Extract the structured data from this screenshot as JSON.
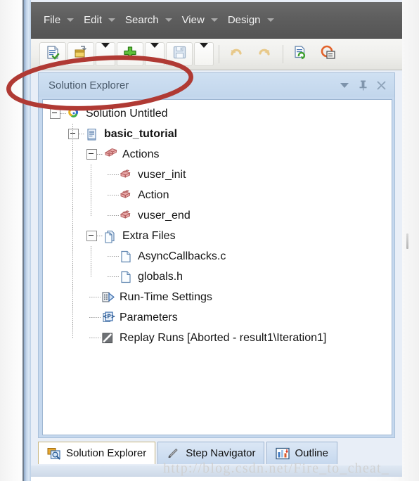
{
  "menubar": {
    "items": [
      {
        "label": "File",
        "accel": "F",
        "name": "menu-file"
      },
      {
        "label": "Edit",
        "accel": "E",
        "name": "menu-edit"
      },
      {
        "label": "Search",
        "accel": "S",
        "name": "menu-search"
      },
      {
        "label": "View",
        "accel": "V",
        "name": "menu-view"
      },
      {
        "label": "Design",
        "accel": "D",
        "name": "menu-design"
      }
    ]
  },
  "toolbar": {
    "buttons": [
      {
        "name": "new-script-button",
        "icon": "new-script-icon"
      },
      {
        "name": "open-solution-button",
        "icon": "open-folder-icon"
      },
      {
        "name": "open-dropdown-button",
        "icon": "chevron-down-icon"
      },
      {
        "name": "add-button",
        "icon": "green-plus-icon"
      },
      {
        "name": "add-dropdown-button",
        "icon": "chevron-down-icon"
      },
      {
        "name": "save-button",
        "icon": "floppy-save-icon"
      },
      {
        "name": "save-dropdown-button",
        "icon": "chevron-down-icon"
      },
      {
        "name": "undo-button",
        "icon": "undo-arrow-icon"
      },
      {
        "name": "redo-button",
        "icon": "redo-arrow-icon"
      },
      {
        "name": "refresh-script-button",
        "icon": "refresh-script-icon"
      },
      {
        "name": "record-button",
        "icon": "record-icon"
      }
    ]
  },
  "panel": {
    "title": "Solution Explorer",
    "header_buttons": [
      {
        "name": "panel-menu-button",
        "icon": "chevron-down-icon",
        "glyph": ""
      },
      {
        "name": "panel-pin-button",
        "icon": "pin-icon",
        "glyph": "⍑"
      },
      {
        "name": "panel-close-button",
        "icon": "close-icon",
        "glyph": "✕"
      }
    ]
  },
  "tree": {
    "nodes": [
      {
        "label": "Solution Untitled",
        "depth": 0,
        "icon": "solution-icon",
        "expander": "minus",
        "bold": false,
        "name": "tree-node-solution-untitled"
      },
      {
        "label": "basic_tutorial",
        "depth": 1,
        "icon": "script-icon",
        "expander": "minus",
        "bold": true,
        "name": "tree-node-basic-tutorial"
      },
      {
        "label": "Actions",
        "depth": 2,
        "icon": "actions-icon",
        "expander": "minus",
        "bold": false,
        "name": "tree-node-actions"
      },
      {
        "label": "vuser_init",
        "depth": 3,
        "icon": "action-block-icon",
        "expander": "none",
        "bold": false,
        "name": "tree-node-vuser-init"
      },
      {
        "label": "Action",
        "depth": 3,
        "icon": "action-block-icon",
        "expander": "none",
        "bold": false,
        "name": "tree-node-action"
      },
      {
        "label": "vuser_end",
        "depth": 3,
        "icon": "action-block-icon",
        "expander": "none",
        "bold": false,
        "name": "tree-node-vuser-end"
      },
      {
        "label": "Extra Files",
        "depth": 2,
        "icon": "extra-files-icon",
        "expander": "minus",
        "bold": false,
        "name": "tree-node-extra-files"
      },
      {
        "label": "AsyncCallbacks.c",
        "depth": 3,
        "icon": "file-icon",
        "expander": "none",
        "bold": false,
        "name": "tree-node-asynccallbacks-c"
      },
      {
        "label": "globals.h",
        "depth": 3,
        "icon": "file-icon",
        "expander": "none",
        "bold": false,
        "name": "tree-node-globals-h"
      },
      {
        "label": "Run-Time Settings",
        "depth": 2,
        "icon": "runtime-settings-icon",
        "expander": "none",
        "bold": false,
        "name": "tree-node-run-time-settings"
      },
      {
        "label": "Parameters",
        "depth": 2,
        "icon": "parameters-icon",
        "expander": "none",
        "bold": false,
        "name": "tree-node-parameters"
      },
      {
        "label": "Replay Runs [Aborted - result1\\Iteration1]",
        "depth": 2,
        "icon": "replay-runs-icon",
        "expander": "none",
        "bold": false,
        "name": "tree-node-replay-runs"
      }
    ]
  },
  "tabs": [
    {
      "label": "Solution Explorer",
      "icon": "solution-explorer-icon",
      "active": true,
      "name": "tab-solution-explorer"
    },
    {
      "label": "Step Navigator",
      "icon": "step-navigator-icon",
      "active": false,
      "name": "tab-step-navigator"
    },
    {
      "label": "Outline",
      "icon": "outline-icon",
      "active": false,
      "name": "tab-outline"
    }
  ],
  "annotation": {
    "shape": "ellipse",
    "color": "#b03a34",
    "target": "Solution Explorer"
  },
  "watermark": {
    "text": "http://blog.csdn.net/Fire_to_cheat_"
  }
}
